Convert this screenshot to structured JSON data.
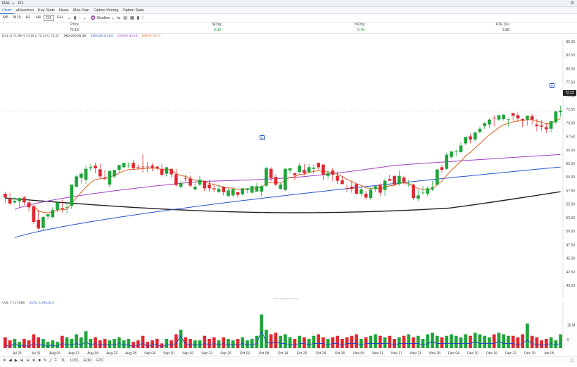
{
  "topbar": {
    "symbol": "DAL",
    "separator": "⬧",
    "interval": "D1"
  },
  "tabs": [
    "Chart",
    "eReaction",
    "Key Stats",
    "News",
    "Max Pain",
    "Option Pricing",
    "Option Stats"
  ],
  "timeframes": [
    "M5",
    "M15",
    "H1",
    "H4",
    "D1",
    "EH"
  ],
  "toolbar": {
    "studies_label": "Studies"
  },
  "stats": {
    "headers": {
      "price": "Price",
      "chg": "$Chg",
      "pct": "%Chg",
      "atr": "ATR (%)"
    },
    "values": {
      "price": "72.15",
      "chg": "0.32",
      "pct": "0.45",
      "atr": "2.86"
    }
  },
  "indicators": {
    "ohlc": "DAL O 71.98 H 73.16 L 71.13 C 72.22",
    "sma200": "SMA200 55.36",
    "sma100": "SMA100 61.84",
    "sma50": "SMA50 64.15",
    "ema8": "EMA8 70.47"
  },
  "volume": {
    "vol": "VOL 7,717,866",
    "svol": "SVOL 1,843,614",
    "axis_label": "15 M",
    "axis_zero": "0"
  },
  "watermark": "www.stoxxplots.com",
  "last_price": "72.22",
  "badges": {
    "event1": "D",
    "event2": "E"
  },
  "price_axis": [
    "85.00",
    "82.50",
    "80.00",
    "77.50",
    "75.00",
    "72.50",
    "70.00",
    "67.50",
    "65.00",
    "62.50",
    "60.00",
    "57.50",
    "55.00",
    "52.50",
    "50.00",
    "47.50",
    "45.00",
    "42.50",
    "40.00"
  ],
  "dates": [
    "Jul 25",
    "Jul 31",
    "Aug 06",
    "Aug 12",
    "Aug 18",
    "Aug 22",
    "Aug 28",
    "Sep 04",
    "Sep 10",
    "Sep 16",
    "Sep 22",
    "Sep 26",
    "Oct 02",
    "Oct 08",
    "Oct 14",
    "Oct 20",
    "Oct 24",
    "Oct 30",
    "Nov 05",
    "Nov 11",
    "Nov 17",
    "Nov 21",
    "Nov 28",
    "Dec 04",
    "Dec 10",
    "Dec 16",
    "Dec 22",
    "Dec 29",
    "Jan 05"
  ],
  "bottom_tools": {
    "tl": "TL",
    "totl": "1OTL",
    "eod": "EOD",
    "gtc": "GTC"
  },
  "colors": {
    "up": "#1ea53a",
    "down": "#e0262f",
    "sma200": "#222222",
    "sma100": "#2255cc",
    "sma50": "#a040c0",
    "ema8": "#e06020",
    "svol": "#2244cc"
  },
  "chart_data": {
    "type": "candlestick",
    "ylim": [
      40,
      85
    ],
    "candles": [
      {
        "o": 56.9,
        "h": 57.3,
        "c": 56.2,
        "l": 55.2
      },
      {
        "o": 55.9,
        "h": 57.1,
        "c": 55.1,
        "l": 54.8
      },
      {
        "o": 55.3,
        "h": 56.3,
        "c": 55.6,
        "l": 55
      },
      {
        "o": 55.5,
        "h": 55.8,
        "c": 56.1,
        "l": 54.3
      },
      {
        "o": 56.2,
        "h": 56.5,
        "c": 55.3,
        "l": 54.8
      },
      {
        "o": 55.3,
        "h": 55.6,
        "c": 54.4,
        "l": 53.6
      },
      {
        "o": 54.6,
        "h": 54.9,
        "c": 51.7,
        "l": 51.3
      },
      {
        "o": 52.1,
        "h": 53.9,
        "c": 50.5,
        "l": 50.2
      },
      {
        "o": 50.6,
        "h": 52.8,
        "c": 52.6,
        "l": 50.1
      },
      {
        "o": 52.7,
        "h": 53.2,
        "c": 53.1,
        "l": 52.1
      },
      {
        "o": 52.6,
        "h": 54.4,
        "c": 53.9,
        "l": 52.3
      },
      {
        "o": 53.9,
        "h": 54.4,
        "c": 55.3,
        "l": 53.5
      },
      {
        "o": 54.3,
        "h": 55.8,
        "c": 54.1,
        "l": 53.4
      },
      {
        "o": 54.3,
        "h": 55.3,
        "c": 54.4,
        "l": 53.2
      },
      {
        "o": 54.7,
        "h": 55.3,
        "c": 58.6,
        "l": 54.1
      },
      {
        "o": 58.2,
        "h": 60.3,
        "c": 60.1,
        "l": 58.1
      },
      {
        "o": 59.8,
        "h": 60.9,
        "c": 60.6,
        "l": 58.8
      },
      {
        "o": 59.5,
        "h": 62.1,
        "c": 61.5,
        "l": 58.7
      },
      {
        "o": 61.6,
        "h": 62.4,
        "c": 61.8,
        "l": 61.1
      },
      {
        "o": 62.1,
        "h": 62.6,
        "c": 61.6,
        "l": 60.7
      },
      {
        "o": 61.4,
        "h": 62.4,
        "c": 60.1,
        "l": 59.7
      },
      {
        "o": 59.9,
        "h": 61.3,
        "c": 59.7,
        "l": 59.5
      },
      {
        "o": 58.6,
        "h": 61.2,
        "c": 61.1,
        "l": 58.1
      },
      {
        "o": 60.1,
        "h": 61.2,
        "c": 61.3,
        "l": 59.8
      },
      {
        "o": 61.3,
        "h": 61.8,
        "c": 62.2,
        "l": 60.7
      },
      {
        "o": 61.8,
        "h": 62.2,
        "c": 62.6,
        "l": 61.7
      },
      {
        "o": 62.1,
        "h": 62.7,
        "c": 62.1,
        "l": 61.6
      },
      {
        "o": 62.6,
        "h": 63.1,
        "c": 61.6,
        "l": 61.4
      },
      {
        "o": 61.8,
        "h": 62.3,
        "c": 61.7,
        "l": 61.4
      },
      {
        "o": 61.9,
        "h": 64.2,
        "c": 61.8,
        "l": 60.8
      },
      {
        "o": 61.9,
        "h": 62.8,
        "c": 61.8,
        "l": 60.8
      },
      {
        "o": 62.1,
        "h": 62.5,
        "c": 61.7,
        "l": 61.1
      },
      {
        "o": 61.9,
        "h": 62.1,
        "c": 61.6,
        "l": 61.2
      },
      {
        "o": 61.5,
        "h": 62.4,
        "c": 60.4,
        "l": 60.1
      },
      {
        "o": 60.6,
        "h": 61.4,
        "c": 61.8,
        "l": 60.1
      },
      {
        "o": 61.5,
        "h": 61.4,
        "c": 60.5,
        "l": 59.9
      },
      {
        "o": 60.5,
        "h": 61.5,
        "c": 58.5,
        "l": 58.2
      },
      {
        "o": 58.2,
        "h": 59.2,
        "c": 58.9,
        "l": 57.9
      },
      {
        "o": 59.7,
        "h": 60.4,
        "c": 59.6,
        "l": 59.2
      },
      {
        "o": 59.7,
        "h": 60.2,
        "c": 58.4,
        "l": 58.1
      },
      {
        "o": 57.7,
        "h": 58.9,
        "c": 58.2,
        "l": 57.5
      },
      {
        "o": 58.6,
        "h": 60.2,
        "c": 59.5,
        "l": 58.3
      },
      {
        "o": 59.3,
        "h": 59.2,
        "c": 57.9,
        "l": 57.4
      },
      {
        "o": 58.6,
        "h": 59.5,
        "c": 57.9,
        "l": 57.3
      },
      {
        "o": 57.9,
        "h": 58.8,
        "c": 57.7,
        "l": 57.2
      },
      {
        "o": 57.2,
        "h": 58.6,
        "c": 57.8,
        "l": 57.1
      },
      {
        "o": 58.2,
        "h": 58.3,
        "c": 57.2,
        "l": 56.6
      },
      {
        "o": 56.5,
        "h": 57.9,
        "c": 57.5,
        "l": 56.3
      },
      {
        "o": 56.6,
        "h": 57.8,
        "c": 57.8,
        "l": 56.2
      },
      {
        "o": 57.2,
        "h": 57.2,
        "c": 56.7,
        "l": 56.2
      },
      {
        "o": 56.8,
        "h": 57.8,
        "c": 57.9,
        "l": 56.6
      },
      {
        "o": 57.6,
        "h": 57.8,
        "c": 57.9,
        "l": 57
      },
      {
        "o": 57.1,
        "h": 58.4,
        "c": 58.3,
        "l": 56.9
      },
      {
        "o": 57.3,
        "h": 58.9,
        "c": 58.3,
        "l": 57.4
      },
      {
        "o": 57.3,
        "h": 58.4,
        "c": 58.3,
        "l": 56.4
      },
      {
        "o": 58.4,
        "h": 61.9,
        "c": 61.6,
        "l": 58.2
      },
      {
        "o": 61.5,
        "h": 61.8,
        "c": 59.8,
        "l": 59.2
      },
      {
        "o": 60,
        "h": 60.5,
        "c": 58.6,
        "l": 58.3
      },
      {
        "o": 57.8,
        "h": 58.9,
        "c": 58.6,
        "l": 57.7
      },
      {
        "o": 57.6,
        "h": 61.7,
        "c": 61.5,
        "l": 57.4
      },
      {
        "o": 61.2,
        "h": 61.7,
        "c": 61.6,
        "l": 60.6
      },
      {
        "o": 60.7,
        "h": 60.6,
        "c": 60.3,
        "l": 59.5
      },
      {
        "o": 60.9,
        "h": 62.5,
        "c": 62.1,
        "l": 60.6
      },
      {
        "o": 61.3,
        "h": 62.4,
        "c": 60.7,
        "l": 60.3
      },
      {
        "o": 60.9,
        "h": 62.4,
        "c": 61.8,
        "l": 60.7
      },
      {
        "o": 61.5,
        "h": 62.3,
        "c": 61.7,
        "l": 60.6
      },
      {
        "o": 62.6,
        "h": 62.7,
        "c": 61.8,
        "l": 61.4
      },
      {
        "o": 62.3,
        "h": 62.3,
        "c": 60.4,
        "l": 59.4
      },
      {
        "o": 60.2,
        "h": 61.2,
        "c": 60.7,
        "l": 59.6
      },
      {
        "o": 61.2,
        "h": 61.7,
        "c": 60.4,
        "l": 59.2
      },
      {
        "o": 60.2,
        "h": 61,
        "c": 59.3,
        "l": 58.7
      },
      {
        "o": 59.4,
        "h": 60.2,
        "c": 58.7,
        "l": 58.6
      },
      {
        "o": 57.9,
        "h": 58.6,
        "c": 57.8,
        "l": 57.2
      },
      {
        "o": 58.2,
        "h": 59.2,
        "c": 57.8,
        "l": 57.1
      },
      {
        "o": 58.7,
        "h": 58.9,
        "c": 56.9,
        "l": 56.8
      },
      {
        "o": 56.9,
        "h": 58.3,
        "c": 57.7,
        "l": 56.4
      },
      {
        "o": 56.9,
        "h": 57.4,
        "c": 56.2,
        "l": 55.8
      },
      {
        "o": 56.1,
        "h": 58,
        "c": 57.7,
        "l": 55.8
      },
      {
        "o": 57.8,
        "h": 58.5,
        "c": 58.3,
        "l": 57.3
      },
      {
        "o": 58.6,
        "h": 58.8,
        "c": 57.1,
        "l": 56.5
      },
      {
        "o": 57.6,
        "h": 59.7,
        "c": 59.3,
        "l": 56.5
      },
      {
        "o": 59.6,
        "h": 60.4,
        "c": 59.3,
        "l": 59.3
      },
      {
        "o": 60.2,
        "h": 60.2,
        "c": 58.6,
        "l": 58.5
      },
      {
        "o": 58.7,
        "h": 61.2,
        "c": 60.2,
        "l": 58.4
      },
      {
        "o": 59.9,
        "h": 60.2,
        "c": 59.1,
        "l": 58.6
      },
      {
        "o": 58.5,
        "h": 59.5,
        "c": 58.6,
        "l": 58.1
      },
      {
        "o": 58.6,
        "h": 58.8,
        "c": 56.1,
        "l": 55.7
      },
      {
        "o": 56,
        "h": 57.6,
        "c": 56.6,
        "l": 55.6
      },
      {
        "o": 57,
        "h": 58.3,
        "c": 57.1,
        "l": 56.8
      },
      {
        "o": 56.9,
        "h": 58.3,
        "c": 57.9,
        "l": 56.4
      },
      {
        "o": 57.7,
        "h": 59.3,
        "c": 58.1,
        "l": 57.4
      },
      {
        "o": 58.6,
        "h": 61.1,
        "c": 61.4,
        "l": 58.3
      },
      {
        "o": 61.8,
        "h": 62.2,
        "c": 61.3,
        "l": 60.8
      },
      {
        "o": 61.5,
        "h": 64.5,
        "c": 64.1,
        "l": 61.3
      },
      {
        "o": 63.7,
        "h": 64.7,
        "c": 64.7,
        "l": 63.4
      },
      {
        "o": 64.6,
        "h": 65.1,
        "c": 64.7,
        "l": 63.8
      },
      {
        "o": 64.6,
        "h": 66.4,
        "c": 65.8,
        "l": 64.5
      },
      {
        "o": 66.2,
        "h": 67.4,
        "c": 67.4,
        "l": 65.9
      },
      {
        "o": 67.5,
        "h": 68,
        "c": 66.9,
        "l": 66.2
      },
      {
        "o": 66.9,
        "h": 68.4,
        "c": 68.2,
        "l": 66.4
      },
      {
        "o": 68.3,
        "h": 69.3,
        "c": 68.9,
        "l": 68.1
      },
      {
        "o": 69.4,
        "h": 70.1,
        "c": 69.9,
        "l": 68.9
      },
      {
        "o": 69.7,
        "h": 70.8,
        "c": 70.6,
        "l": 69.1
      },
      {
        "o": 70.9,
        "h": 71.4,
        "c": 70.8,
        "l": 69.4
      },
      {
        "o": 70.6,
        "h": 71.5,
        "c": 71.4,
        "l": 70.3
      },
      {
        "o": 70.7,
        "h": 71.6,
        "c": 71.5,
        "l": 70.4
      },
      {
        "o": 70.7,
        "h": 70.4,
        "c": 70.7,
        "l": 69.3
      },
      {
        "o": 71.8,
        "h": 71.7,
        "c": 71.3,
        "l": 70.4
      },
      {
        "o": 71.4,
        "h": 71.9,
        "c": 70.8,
        "l": 70.2
      },
      {
        "o": 70.7,
        "h": 70.8,
        "c": 70.5,
        "l": 69.2
      },
      {
        "o": 70.6,
        "h": 71,
        "c": 71.3,
        "l": 69.5
      },
      {
        "o": 71.2,
        "h": 71.6,
        "c": 70.6,
        "l": 69.7
      },
      {
        "o": 69.7,
        "h": 70.7,
        "c": 69.4,
        "l": 68.4
      },
      {
        "o": 69.5,
        "h": 70.5,
        "c": 69.3,
        "l": 68.6
      },
      {
        "o": 69.2,
        "h": 69.9,
        "c": 68.8,
        "l": 68.1
      },
      {
        "o": 68.9,
        "h": 69.9,
        "c": 70.3,
        "l": 68.2
      },
      {
        "o": 70.1,
        "h": 72.1,
        "c": 72.1,
        "l": 69.7
      },
      {
        "o": 71.98,
        "h": 73.16,
        "c": 72.22,
        "l": 71.13
      }
    ],
    "volume_millions": [
      7,
      5,
      6,
      4,
      6,
      5,
      9,
      7,
      6,
      4,
      5,
      4,
      8,
      7,
      6,
      9,
      7,
      11,
      6,
      7,
      5,
      6,
      5,
      6,
      7,
      5,
      6,
      4,
      5,
      8,
      4,
      5,
      6,
      3,
      6,
      5,
      9,
      12,
      7,
      6,
      5,
      5,
      8,
      6,
      7,
      5,
      7,
      6,
      5,
      6,
      7,
      5,
      6,
      8,
      22,
      12,
      9,
      10,
      8,
      9,
      7,
      6,
      8,
      7,
      6,
      8,
      9,
      7,
      6,
      7,
      8,
      6,
      7,
      8,
      9,
      6,
      7,
      8,
      9,
      8,
      7,
      8,
      6,
      7,
      8,
      9,
      7,
      8,
      6,
      9,
      10,
      8,
      7,
      8,
      9,
      8,
      7,
      9,
      8,
      10,
      9,
      8,
      7,
      9,
      10,
      9,
      8,
      8,
      7,
      9,
      16,
      8,
      7,
      5,
      6,
      7,
      5,
      9,
      8,
      8
    ],
    "svol_millions": [
      2,
      1,
      3,
      1,
      2,
      1,
      3,
      2,
      2,
      1,
      2,
      1,
      3,
      2,
      2,
      3,
      2,
      4,
      2,
      3,
      2,
      2,
      2,
      2,
      3,
      2,
      2,
      1,
      2,
      3,
      1,
      2,
      2,
      1,
      2,
      2,
      3,
      8,
      2,
      2,
      2,
      2,
      3,
      2,
      3,
      2,
      3,
      2,
      2,
      2,
      3,
      2,
      2,
      3,
      11,
      4,
      3,
      4,
      3,
      3,
      2,
      2,
      3,
      3,
      2,
      3,
      3,
      3,
      2,
      3,
      3,
      2,
      3,
      3,
      3,
      2,
      3,
      3,
      3,
      3,
      3,
      3,
      2,
      3,
      3,
      3,
      3,
      3,
      2,
      3,
      4,
      3,
      3,
      3,
      3,
      3,
      3,
      3,
      3,
      4,
      3,
      3,
      3,
      3,
      4,
      3,
      3,
      3,
      2,
      3,
      5,
      3,
      2,
      2,
      2,
      3,
      2,
      3,
      3,
      3
    ]
  }
}
